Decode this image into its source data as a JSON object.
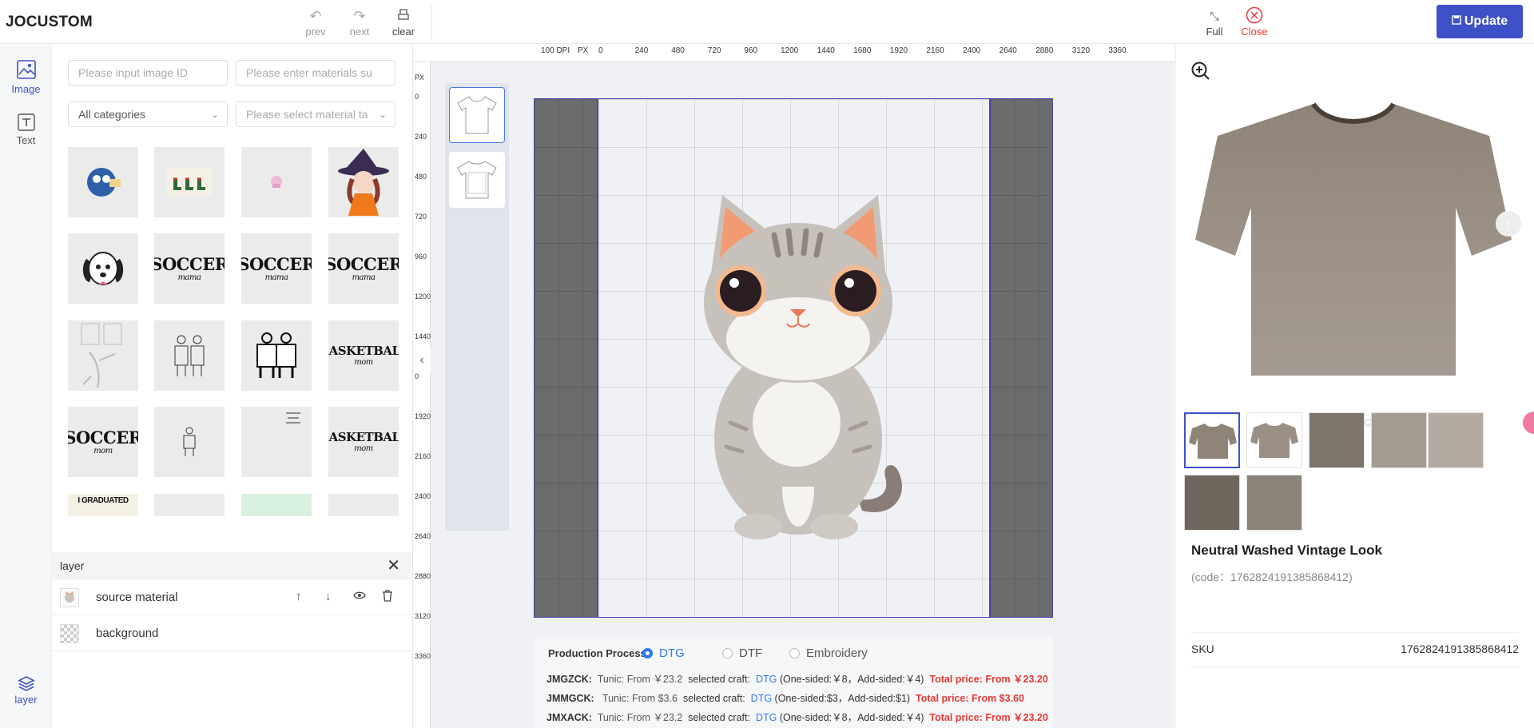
{
  "app": {
    "brand": "JOCUSTOM"
  },
  "toolbar": {
    "prev": "prev",
    "next": "next",
    "clear": "clear",
    "full": "Full",
    "close": "Close",
    "update": "Update"
  },
  "leftrail": {
    "image": "Image",
    "text": "Text",
    "layer": "layer"
  },
  "filters": {
    "image_id_placeholder": "Please input image ID",
    "materials_placeholder": "Please enter materials su",
    "category_value": "All categories",
    "tag_placeholder": "Please select material ta"
  },
  "materials": [
    {
      "label": "",
      "icon": "blue-monster-sticker"
    },
    {
      "label": "",
      "icon": "boots-sticker"
    },
    {
      "label": "",
      "icon": "pink-cupcake"
    },
    {
      "label": "",
      "icon": "witch-girl"
    },
    {
      "label": "",
      "icon": "dog-face"
    },
    {
      "label": "SOCCER",
      "sub": "mama"
    },
    {
      "label": "SOCCER",
      "sub": "mama"
    },
    {
      "label": "SOCCER",
      "sub": "mama"
    },
    {
      "label": "",
      "icon": "sketch-drawing"
    },
    {
      "label": "",
      "icon": "players-sketch"
    },
    {
      "label": "",
      "icon": "players-jerseys"
    },
    {
      "label": "BASKETBALL",
      "sub": "mom"
    },
    {
      "label": "SOCCER",
      "sub": "mom"
    },
    {
      "label": "",
      "icon": "player-small"
    },
    {
      "label": "",
      "icon": "small-text-art"
    },
    {
      "label": "BASKETBALL",
      "sub": "mom"
    },
    {
      "label": "I GRADUATED",
      "sub": ""
    },
    {
      "label": "",
      "icon": "pink-bow"
    },
    {
      "label": "",
      "icon": "green-art"
    },
    {
      "label": "",
      "icon": "dog-art"
    }
  ],
  "layers": {
    "title": "layer",
    "items": [
      {
        "name": "source material"
      },
      {
        "name": "background"
      }
    ]
  },
  "ruler": {
    "dpi": "100 DPI",
    "unit": "PX",
    "top_ticks": [
      "0",
      "240",
      "480",
      "720",
      "960",
      "1200",
      "1440",
      "1680",
      "1920",
      "2160",
      "2400",
      "2640",
      "2880",
      "3120",
      "3360"
    ],
    "left_ticks": [
      "0",
      "240",
      "480",
      "720",
      "960",
      "1200",
      "1440",
      "0",
      "1920",
      "2160",
      "2400",
      "2640",
      "2880",
      "3120",
      "3360"
    ]
  },
  "production": {
    "label": "Production Process:",
    "options": [
      "DTG",
      "DTF",
      "Embroidery"
    ],
    "selected": "DTG",
    "lines": [
      {
        "code": "JMGZCK:",
        "desc": "Tunic: From ￥23.2",
        "craft_label": "selected craft:",
        "craft": "DTG",
        "detail": "(One-sided:￥8，Add-sided:￥4)",
        "total": "Total price: From ￥23.20"
      },
      {
        "code": "JMMGCK:",
        "desc": "Tunic: From $3.6",
        "craft_label": "selected craft:",
        "craft": "DTG",
        "detail": "(One-sided:$3，Add-sided:$1)",
        "total": "Total price: From $3.60"
      },
      {
        "code": "JMXACK:",
        "desc": "Tunic: From ￥23.2",
        "craft_label": "selected craft:",
        "craft": "DTG",
        "detail": "(One-sided:￥8，Add-sided:￥4)",
        "total": "Total price: From ￥23.20"
      }
    ]
  },
  "product": {
    "title": "Neutral Washed Vintage Look",
    "code": "(code：1762824191385868412)",
    "sku_label": "SKU",
    "sku_value": "1762824191385868412",
    "carousel_count": 7,
    "carousel_active": 1
  },
  "colors": {
    "accent": "#3f51c6",
    "danger": "#e53935",
    "link": "#2f7be6",
    "shirt": "#9a8f85"
  }
}
